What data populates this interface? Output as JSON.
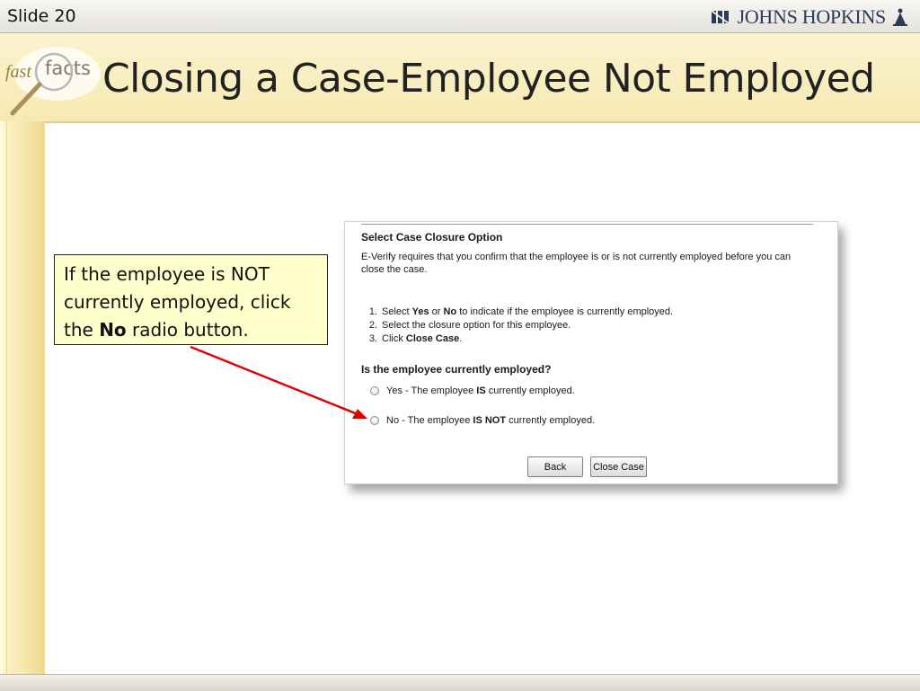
{
  "slide": {
    "number_label": "Slide 20",
    "title": "Closing a Case-Employee Not Employed"
  },
  "brand": {
    "name": "JOHNS HOPKINS",
    "logo": {
      "fast": "fast",
      "facts": "facts"
    }
  },
  "callout": {
    "text_before": "If the employee is NOT currently employed, click the ",
    "emphasis": "No",
    "text_after": " radio button."
  },
  "form": {
    "heading": "Select Case Closure Option",
    "intro": "E-Verify requires that you confirm that the employee is or is not currently employed before you can close the case.",
    "steps": [
      {
        "num": "1.",
        "pre": "Select ",
        "b1": "Yes",
        "mid": " or ",
        "b2": "No",
        "post": " to indicate if the employee is currently employed."
      },
      {
        "num": "2.",
        "text": "Select the closure option for this employee."
      },
      {
        "num": "3.",
        "pre": "Click ",
        "b1": "Close Case",
        "post": "."
      }
    ],
    "question": "Is the employee currently employed?",
    "options": [
      {
        "pre": "Yes - The employee ",
        "bold": "IS",
        "post": " currently employed.",
        "selected": false
      },
      {
        "pre": "No - The employee ",
        "bold": "IS NOT",
        "post": " currently employed.",
        "selected": false
      }
    ],
    "buttons": {
      "back": "Back",
      "close_case": "Close Case"
    }
  },
  "colors": {
    "arrow": "#e00000",
    "callout_bg": "#ffffcc",
    "title_band": "#f8edbd",
    "brand": "#2a3a5c"
  },
  "icons": {
    "brand_shield": "shield-icon",
    "brand_figure": "figure-icon",
    "logo_magnifier": "magnifier-icon"
  }
}
